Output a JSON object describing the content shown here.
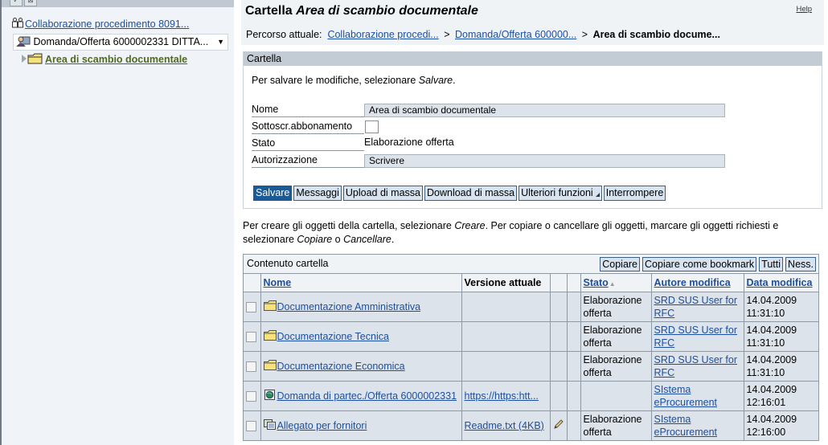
{
  "left_panel": {
    "toolbar_icons": [
      "check-icon",
      "collapse-icon"
    ],
    "tree_root": {
      "label": "Collaborazione procedimento 8091...",
      "icon": "people-icon"
    },
    "selected_node": {
      "label": "Domanda/Offerta 6000002331 DITTA...",
      "icon": "user-group-icon"
    },
    "child_node": {
      "label": "Area di scambio documentale",
      "icon": "folder-icon"
    }
  },
  "header": {
    "title_prefix": "Cartella",
    "title_name": "Area di scambio documentale",
    "help": "Help",
    "breadcrumb_label": "Percorso attuale:",
    "breadcrumb": [
      {
        "label": "Collaborazione procedi...",
        "link": true
      },
      {
        "label": "Domanda/Offerta 600000...",
        "link": true
      },
      {
        "label": "Area di scambio docume...",
        "link": false
      }
    ],
    "separator": ">"
  },
  "folder_panel": {
    "title": "Cartella",
    "hint_prefix": "Per salvare le modifiche, selezionare ",
    "hint_action": "Salvare",
    "hint_suffix": ".",
    "fields": {
      "nome": {
        "label": "Nome",
        "value": "Area di scambio documentale"
      },
      "sottoscr": {
        "label": "Sottoscr.abbonamento",
        "checked": false
      },
      "stato": {
        "label": "Stato",
        "value": "Elaborazione offerta"
      },
      "autorizzazione": {
        "label": "Autorizzazione",
        "value": "Scrivere"
      }
    },
    "buttons": {
      "salvare": "Salvare",
      "messaggi": "Messaggi",
      "upload": "Upload di massa",
      "download": "Download di massa",
      "ulteriori": "Ulteriori funzioni",
      "interrompere": "Interrompere"
    }
  },
  "info_text": {
    "p1": "Per creare gli oggetti della cartella, selezionare ",
    "a1": "Creare",
    "p2": ". Per copiare o cancellare gli oggetti, marcare gli oggetti richiesti e selezionare ",
    "a2": "Copiare",
    "p3": " o ",
    "a3": "Cancellare",
    "p4": "."
  },
  "content_table": {
    "title": "Contenuto cartella",
    "buttons": {
      "copiare": "Copiare",
      "bookmark": "Copiare come bookmark",
      "tutti": "Tutti",
      "ness": "Ness."
    },
    "columns": {
      "nome": "Nome",
      "versione": "Versione attuale",
      "stato": "Stato",
      "autore": "Autore modifica",
      "data": "Data modifica"
    },
    "sort_indicator": "▲",
    "rows": [
      {
        "icon": "folder-icon",
        "nome": "Documentazione Amministrativa",
        "versione": "",
        "edit": false,
        "stato": "Elaborazione offerta",
        "autore": "SRD SUS User for RFC",
        "data": "14.04.2009 11:31:10"
      },
      {
        "icon": "folder-icon",
        "nome": "Documentazione Tecnica",
        "versione": "",
        "edit": false,
        "stato": "Elaborazione offerta",
        "autore": "SRD SUS User for RFC",
        "data": "14.04.2009 11:31:10"
      },
      {
        "icon": "folder-icon",
        "nome": "Documentazione Economica",
        "versione": "",
        "edit": false,
        "stato": "Elaborazione offerta",
        "autore": "SRD SUS User for RFC",
        "data": "14.04.2009 11:31:10"
      },
      {
        "icon": "web-link-icon",
        "nome": "Domanda di partec./Offerta 6000002331",
        "versione": "https://https:htt...",
        "edit": false,
        "stato": "",
        "autore": "SIstema eProcurement",
        "data": "14.04.2009 12:16:01"
      },
      {
        "icon": "document-icon",
        "nome": "Allegato per fornitori",
        "versione": "Readme.txt (4KB)",
        "edit": true,
        "stato": "Elaborazione offerta",
        "autore": "SIstema eProcurement",
        "data": "14.04.2009 12:16:00"
      }
    ]
  }
}
